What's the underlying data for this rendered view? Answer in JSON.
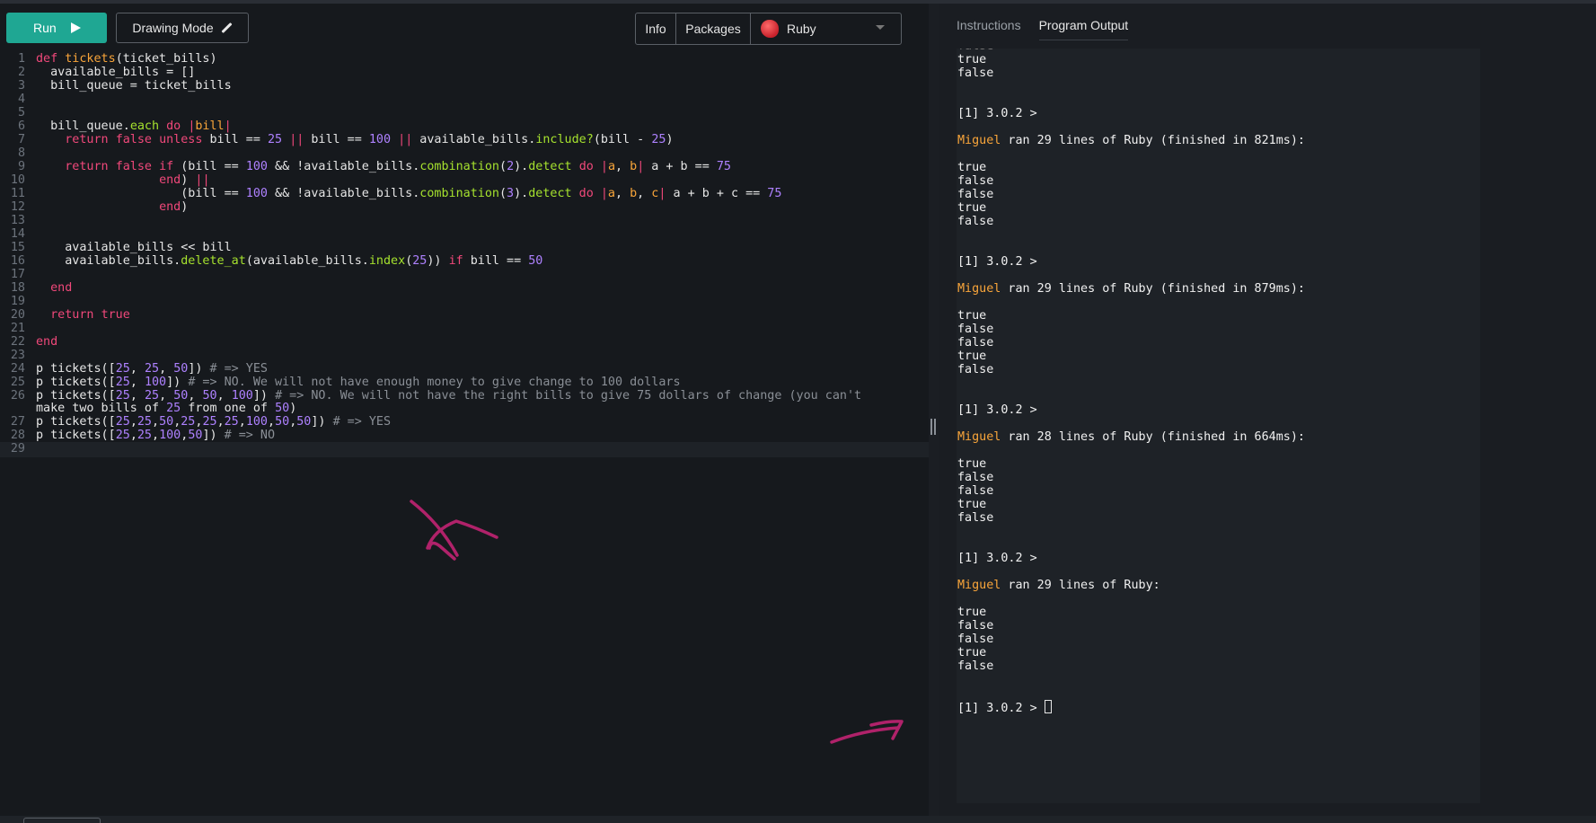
{
  "toolbar": {
    "run_label": "Run",
    "drawing_label": "Drawing Mode",
    "info_label": "Info",
    "packages_label": "Packages",
    "language": "Ruby"
  },
  "editor": {
    "line_numbers": [
      "1",
      "2",
      "3",
      "4",
      "5",
      "6",
      "7",
      "8",
      "9",
      "10",
      "11",
      "12",
      "13",
      "14",
      "15",
      "16",
      "17",
      "18",
      "19",
      "20",
      "21",
      "22",
      "23",
      "24",
      "25",
      "26",
      "",
      "27",
      "28",
      "29"
    ],
    "lines": [
      "def tickets(ticket_bills)",
      "  available_bills = []",
      "  bill_queue = ticket_bills",
      "",
      "",
      "  bill_queue.each do |bill|",
      "    return false unless bill == 25 || bill == 100 || available_bills.include?(bill - 25)",
      "",
      "    return false if (bill == 100 && !available_bills.combination(2).detect do |a, b| a + b == 75",
      "                 end) ||",
      "                    (bill == 100 && !available_bills.combination(3).detect do |a, b, c| a + b + c == 75",
      "                 end)",
      "",
      "",
      "    available_bills << bill",
      "    available_bills.delete_at(available_bills.index(25)) if bill == 50",
      "",
      "  end",
      "",
      "  return true",
      "",
      "end",
      "",
      "p tickets([25, 25, 50]) # => YES",
      "p tickets([25, 100]) # => NO. We will not have enough money to give change to 100 dollars",
      "p tickets([25, 25, 50, 50, 100]) # => NO. We will not have the right bills to give 75 dollars of change (you can't",
      "make two bills of 25 from one of 50)",
      "p tickets([25,25,50,25,25,25,100,50,50]) # => YES",
      "p tickets([25,25,100,50]) # => NO",
      ""
    ]
  },
  "panel": {
    "tab_instructions": "Instructions",
    "tab_output": "Program Output"
  },
  "output": {
    "lines": [
      {
        "t": "false",
        "faded": true
      },
      {
        "t": "true"
      },
      {
        "t": "false"
      },
      {
        "t": ""
      },
      {
        "t": ""
      },
      {
        "t": "[1] 3.0.2 >"
      },
      {
        "t": ""
      },
      {
        "user": "Miguel",
        "t": " ran 29 lines of Ruby (finished in 821ms):"
      },
      {
        "t": ""
      },
      {
        "t": "true"
      },
      {
        "t": "false"
      },
      {
        "t": "false"
      },
      {
        "t": "true"
      },
      {
        "t": "false"
      },
      {
        "t": ""
      },
      {
        "t": ""
      },
      {
        "t": "[1] 3.0.2 >"
      },
      {
        "t": ""
      },
      {
        "user": "Miguel",
        "t": " ran 29 lines of Ruby (finished in 879ms):"
      },
      {
        "t": ""
      },
      {
        "t": "true"
      },
      {
        "t": "false"
      },
      {
        "t": "false"
      },
      {
        "t": "true"
      },
      {
        "t": "false"
      },
      {
        "t": ""
      },
      {
        "t": ""
      },
      {
        "t": "[1] 3.0.2 >"
      },
      {
        "t": ""
      },
      {
        "user": "Miguel",
        "t": " ran 28 lines of Ruby (finished in 664ms):"
      },
      {
        "t": ""
      },
      {
        "t": "true"
      },
      {
        "t": "false"
      },
      {
        "t": "false"
      },
      {
        "t": "true"
      },
      {
        "t": "false"
      },
      {
        "t": ""
      },
      {
        "t": ""
      },
      {
        "t": "[1] 3.0.2 >"
      },
      {
        "t": ""
      },
      {
        "user": "Miguel",
        "t": " ran 29 lines of Ruby:"
      },
      {
        "t": ""
      },
      {
        "t": "true"
      },
      {
        "t": "false"
      },
      {
        "t": "false"
      },
      {
        "t": "true"
      },
      {
        "t": "false"
      },
      {
        "t": ""
      },
      {
        "t": ""
      },
      {
        "t": "[1] 3.0.2 > ",
        "cursor": true
      }
    ]
  },
  "colors": {
    "run_button": "#1fa793",
    "keyword": "#f0487a",
    "function": "#f9a53a",
    "method": "#a6e22e",
    "number": "#ae81ff",
    "comment": "#8a8f96",
    "annotation": "#b0226a"
  }
}
